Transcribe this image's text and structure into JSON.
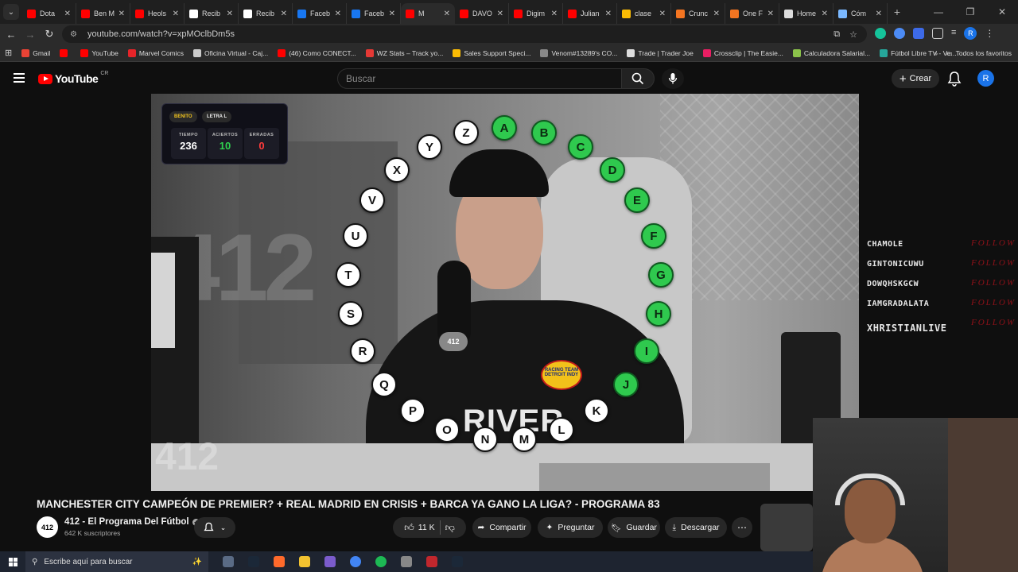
{
  "browser": {
    "tabs": [
      {
        "label": "Dota",
        "color": "#ff0000"
      },
      {
        "label": "Ben M",
        "color": "#ff0000"
      },
      {
        "label": "Heols",
        "color": "#ff0000"
      },
      {
        "label": "Recib",
        "color": "#ffffff"
      },
      {
        "label": "Recib",
        "color": "#ffffff"
      },
      {
        "label": "Faceb",
        "color": "#1877f2"
      },
      {
        "label": "Faceb",
        "color": "#1877f2"
      },
      {
        "label": "M",
        "color": "#ff0000",
        "active": true
      },
      {
        "label": "DAVO",
        "color": "#ff0000"
      },
      {
        "label": "Digim",
        "color": "#ff0000"
      },
      {
        "label": "Julian",
        "color": "#ff0000"
      },
      {
        "label": "clase",
        "color": "#fbbc04"
      },
      {
        "label": "Crunc",
        "color": "#f47521"
      },
      {
        "label": "One F",
        "color": "#f47521"
      },
      {
        "label": "Home",
        "color": "#dddddd"
      },
      {
        "label": "Cóm",
        "color": "#7ab8ff"
      }
    ],
    "url": "youtube.com/watch?v=xpMOclbDm5s",
    "bookmarks": [
      {
        "label": "Gmail",
        "color": "#ea4335"
      },
      {
        "label": "",
        "color": "#ff0000"
      },
      {
        "label": "YouTube",
        "color": "#ff0000"
      },
      {
        "label": "Marvel Comics",
        "color": "#e62429"
      },
      {
        "label": "Oficina Virtual - Caj...",
        "color": "#cccccc"
      },
      {
        "label": "(46) Como CONECT...",
        "color": "#ff0000"
      },
      {
        "label": "WZ Stats – Track yo...",
        "color": "#e53935"
      },
      {
        "label": "Sales Support Speci...",
        "color": "#fbbc04"
      },
      {
        "label": "Venom#13289's CO...",
        "color": "#888888"
      },
      {
        "label": "Trade | Trader Joe",
        "color": "#dddddd"
      },
      {
        "label": "Crossclip | The Easie...",
        "color": "#e91e63"
      },
      {
        "label": "Calculadora Salarial...",
        "color": "#8bc34a"
      },
      {
        "label": "Fútbol Libre TV - Ve...",
        "color": "#26a69a"
      }
    ],
    "bookmarks_more": "»",
    "all_favorites": "Todos los favoritos"
  },
  "youtube": {
    "logo_text": "YouTube",
    "country": "CR",
    "search_placeholder": "Buscar",
    "create_label": "Crear",
    "avatar_letter": "R"
  },
  "overlay": {
    "player_name": "BENITO",
    "letter_label": "LETRA L",
    "stats": [
      {
        "label": "TIEMPO",
        "value": "236",
        "color": "#ffffff"
      },
      {
        "label": "ACIERTOS",
        "value": "10",
        "color": "#2fd14f"
      },
      {
        "label": "ERRADAS",
        "value": "0",
        "color": "#ff3b3b"
      }
    ],
    "letters_white": [
      "Z",
      "Y",
      "X",
      "V",
      "U",
      "T",
      "S",
      "R",
      "Q",
      "P",
      "O",
      "N",
      "M",
      "L",
      "K"
    ],
    "letters_green": [
      "A",
      "B",
      "C",
      "D",
      "E",
      "F",
      "G",
      "H",
      "I",
      "J"
    ],
    "shirt_text": "RIVER",
    "mic_label": "412",
    "badge_text": "RACING TEAM DETROIT INDY",
    "watermark": "412"
  },
  "chat_side": [
    {
      "name": "CHAMOLE",
      "action": "FOLLOW"
    },
    {
      "name": "GINTONICUWU",
      "action": "FOLLOW"
    },
    {
      "name": "DOWQHSKGCW",
      "action": "FOLLOW"
    },
    {
      "name": "IAMGRADALATA",
      "action": "FOLLOW"
    },
    {
      "name": "XHRISTIANLIVE",
      "action": "FOLLOW"
    }
  ],
  "video": {
    "title": "MANCHESTER CITY CAMPEÓN DE PREMIER? + REAL MADRID EN CRISIS + BARCA YA GANO LA LIGA? - PROGRAMA 83",
    "channel": "412 - El Programa Del Fútbol",
    "channel_avatar": "412",
    "subscribers": "642 K suscriptores",
    "likes": "11 K",
    "share": "Compartir",
    "ask": "Preguntar",
    "save": "Guardar",
    "download": "Descargar"
  },
  "taskbar": {
    "search_placeholder": "Escribe aquí para buscar",
    "apps": [
      "#5a6b85",
      "#1b2838",
      "#ff6a2b",
      "#f2c230",
      "#7b5ccc",
      "#4285f4",
      "#1db954",
      "#888888",
      "#c1272d",
      "#1b2838"
    ]
  }
}
